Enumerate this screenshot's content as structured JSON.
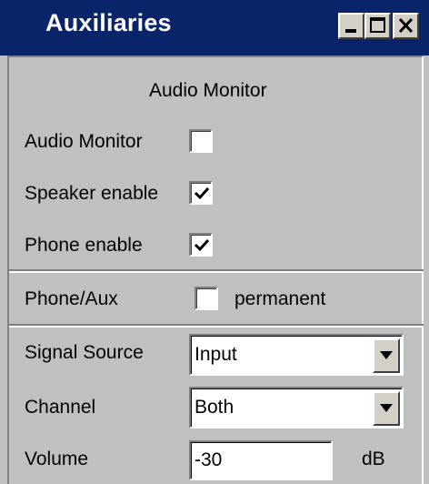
{
  "window": {
    "title": "Auxiliaries",
    "controls": [
      "minimize-icon",
      "maximize-icon",
      "close-icon"
    ]
  },
  "section_header": "Audio Monitor",
  "audio_monitor": {
    "label": "Audio Monitor",
    "checked": false
  },
  "speaker_enable": {
    "label": "Speaker enable",
    "checked": true
  },
  "phone_enable": {
    "label": "Phone enable",
    "checked": true
  },
  "phone_aux": {
    "label": "Phone/Aux",
    "checked": false,
    "option_label": "permanent"
  },
  "signal_source": {
    "label": "Signal Source",
    "value": "Input"
  },
  "channel": {
    "label": "Channel",
    "value": "Both"
  },
  "volume": {
    "label": "Volume",
    "value": "-30",
    "unit": "dB"
  },
  "colors": {
    "title_bar": "#0a246a",
    "panel": "#c0c0c0"
  }
}
